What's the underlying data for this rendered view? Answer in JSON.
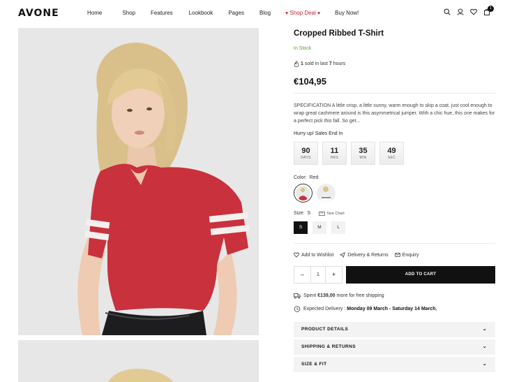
{
  "brand": {
    "logo": "AVONE"
  },
  "nav": {
    "items": [
      {
        "label": "Home"
      },
      {
        "label": "Shop"
      },
      {
        "label": "Features"
      },
      {
        "label": "Lookbook"
      },
      {
        "label": "Pages"
      },
      {
        "label": "Blog"
      },
      {
        "label": "Shop Deal",
        "heart": "♥"
      },
      {
        "label": "Buy Now!"
      }
    ]
  },
  "header_icons": {
    "cart_count": "1"
  },
  "product": {
    "title": "Cropped Ribbed T-Shirt",
    "stock": "In Stock",
    "sold_count": "1",
    "sold_text_mid": "sold in last",
    "sold_hours": "7",
    "sold_text_end": "hours",
    "price": "€104,95",
    "description": "SPECIFICATION A little crisp, a little sunny, warm enough to skip a coat, just cool enough to wrap great cashmere around is this asymmetrical jumper. With a chic hue, this one makes for a perfect pick this fall. So get...",
    "hurry_text": "Hurry up! Sales End In",
    "countdown": [
      {
        "value": "90",
        "label": "DAYS"
      },
      {
        "value": "11",
        "label": "HRS"
      },
      {
        "value": "35",
        "label": "MIN"
      },
      {
        "value": "49",
        "label": "SEC"
      }
    ],
    "color_label": "Color:",
    "color_value": "Red",
    "size_label": "Size:",
    "size_value": "S",
    "size_chart": "Size Chart",
    "sizes": [
      "S",
      "M",
      "L"
    ],
    "quantity": "1",
    "add_to_cart": "ADD TO CART",
    "links": {
      "wishlist": "Add to Wishlist",
      "delivery": "Delivery & Returns",
      "enquiry": "Enquiry"
    },
    "shipping_prefix": "Spent",
    "shipping_amount": "€139,00",
    "shipping_suffix": "more for free shipping",
    "delivery_label": "Expected Delivery :",
    "delivery_dates": "Monday 09 March - Saturday 14 March.",
    "accordion": [
      {
        "label": "PRODUCT DETAILS"
      },
      {
        "label": "SHIPPING & RETURNS"
      },
      {
        "label": "SIZE & FIT"
      }
    ]
  },
  "colors": {
    "accent_red": "#c8262b",
    "stock_green": "#5a9e3c",
    "dark": "#111111"
  }
}
